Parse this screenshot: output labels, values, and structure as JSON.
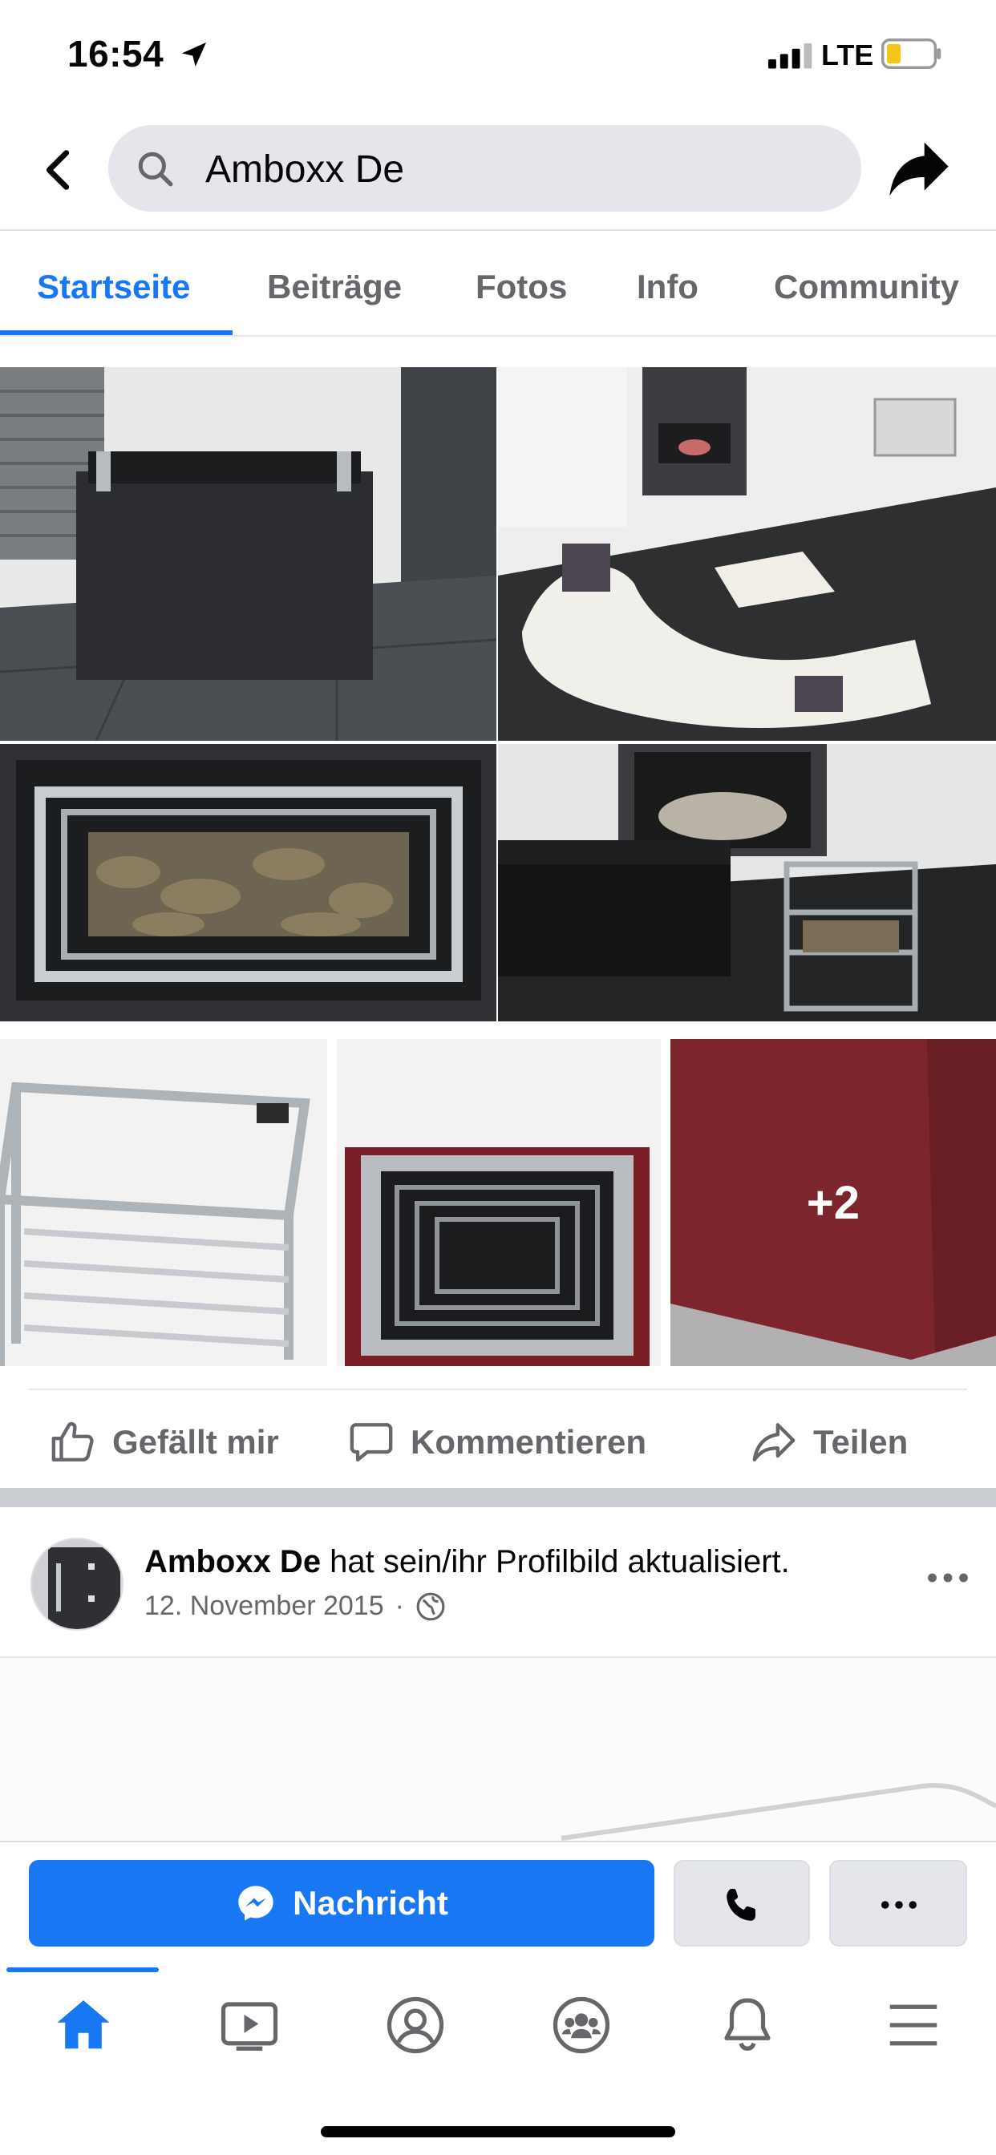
{
  "status_bar": {
    "time": "16:54",
    "network": "LTE",
    "battery_color": "#f5c518"
  },
  "search": {
    "query": "Amboxx De"
  },
  "tabs": [
    {
      "label": "Startseite",
      "active": true
    },
    {
      "label": "Beiträge"
    },
    {
      "label": "Fotos"
    },
    {
      "label": "Info"
    },
    {
      "label": "Community"
    }
  ],
  "photos": {
    "more_count": "+2"
  },
  "actions": {
    "like": "Gefällt mir",
    "comment": "Kommentieren",
    "share": "Teilen"
  },
  "post": {
    "author": "Amboxx De",
    "action_text": " hat sein/ihr Profilbild aktualisiert.",
    "date": "12. November 2015",
    "separator": "·"
  },
  "cta": {
    "message": "Nachricht"
  },
  "colors": {
    "accent": "#1877f2",
    "muted": "#65676b",
    "surface": "#e4e6eb"
  },
  "icons": {
    "nav": [
      "home-icon",
      "watch-icon",
      "profile-icon",
      "groups-icon",
      "notifications-icon",
      "menu-icon"
    ]
  }
}
